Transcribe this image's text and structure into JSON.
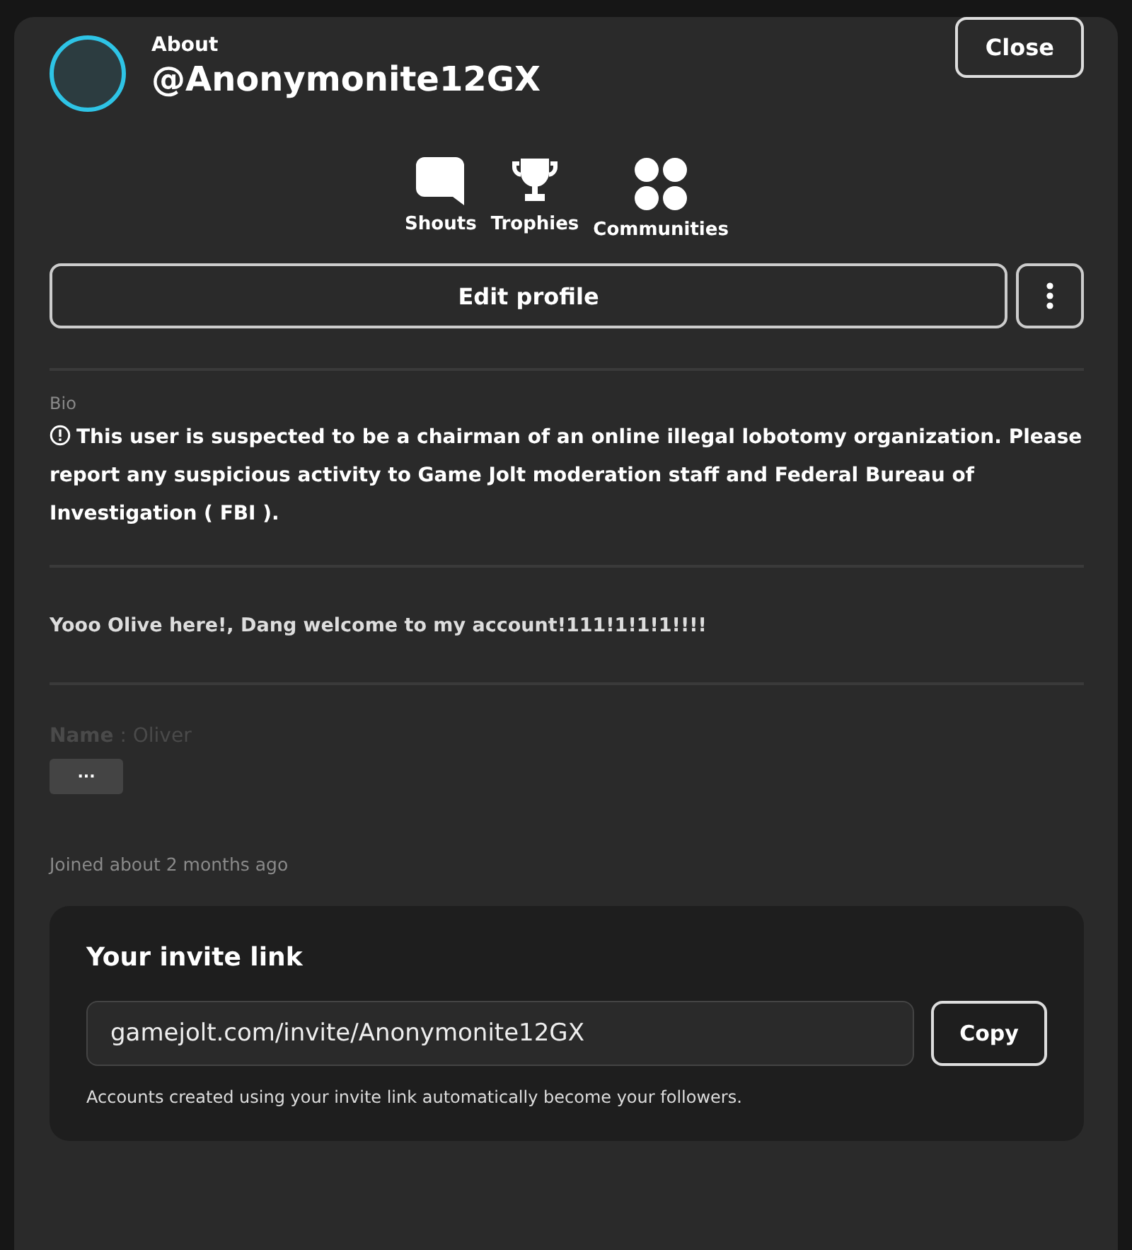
{
  "header": {
    "label": "About",
    "username": "@Anonymonite12GX",
    "close": "Close"
  },
  "nav": [
    {
      "label": "Shouts",
      "kind": "shouts"
    },
    {
      "label": "Trophies",
      "kind": "trophies"
    },
    {
      "label": "Communities",
      "kind": "communities"
    }
  ],
  "edit_button": "Edit profile",
  "bio": {
    "label": "Bio",
    "warning": "This user is suspected to be a chairman of an online illegal lobotomy organization. Please report any suspicious activity to Game Jolt moderation staff and Federal Bureau of Investigation ( FBI ).",
    "greeting": "Yooo Olive here!, Dang welcome to my account!111!1!1!1!!!!",
    "name_line": "**Name** : Oliver",
    "more": "···"
  },
  "joined": "Joined about 2 months ago",
  "invite": {
    "title": "Your invite link",
    "value": "gamejolt.com/invite/Anonymonite12GX",
    "copy": "Copy",
    "note": "Accounts created using your invite link automatically become your followers."
  }
}
